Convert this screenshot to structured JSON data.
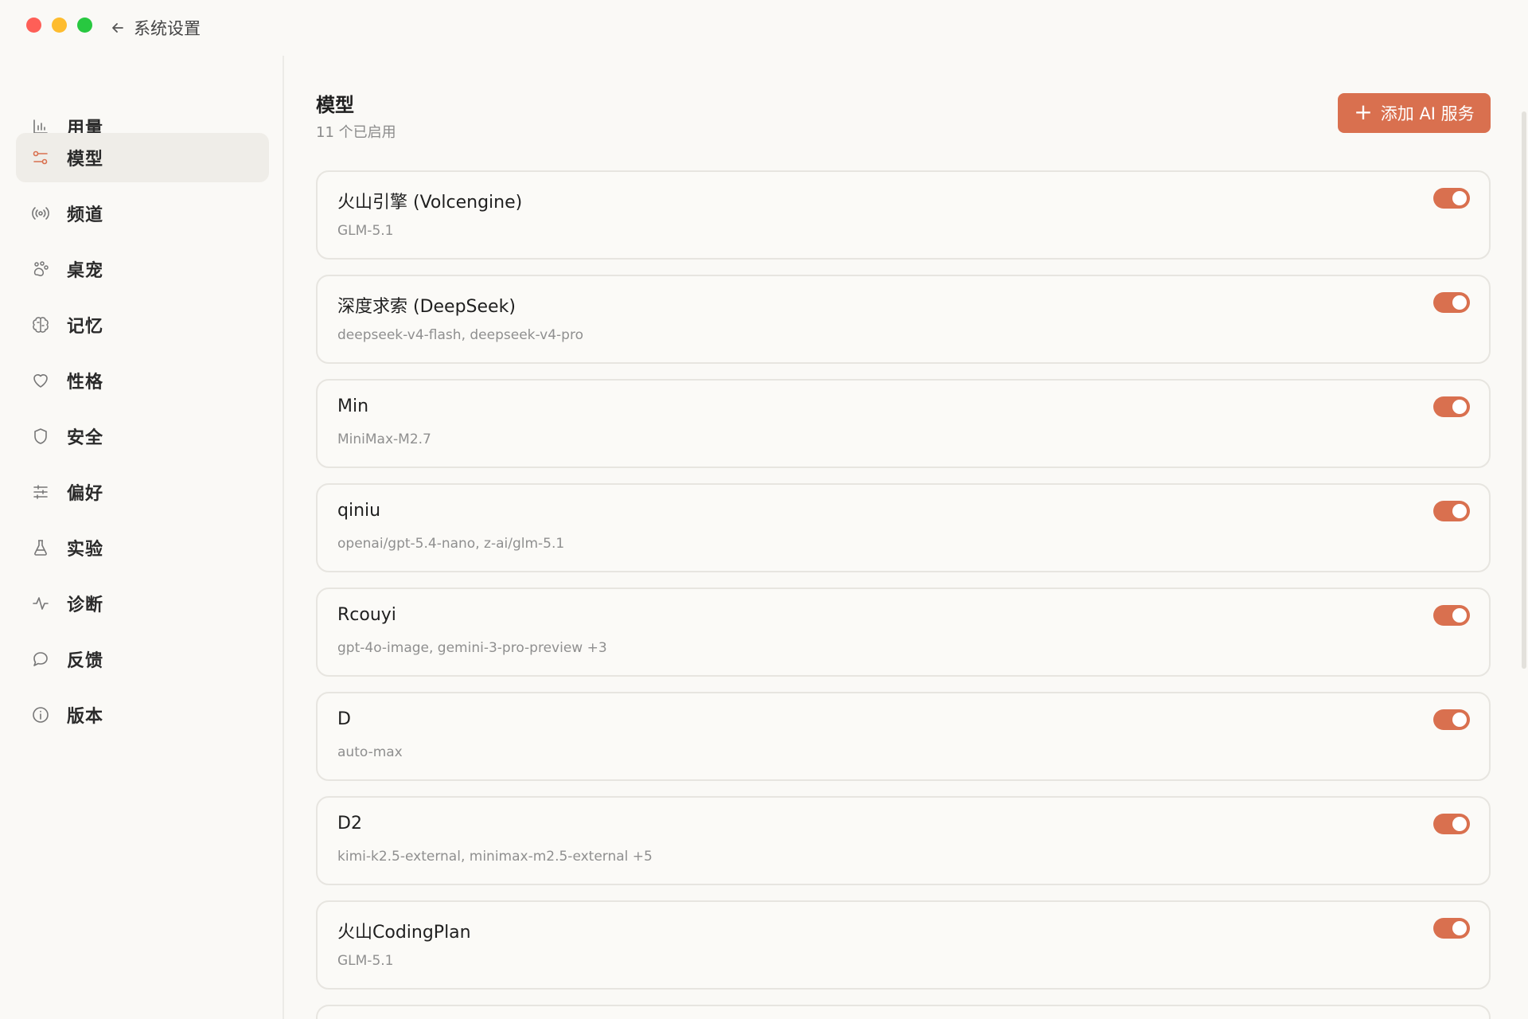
{
  "window": {
    "back_label": "系统设置"
  },
  "sidebar": {
    "items": [
      {
        "label": "用量",
        "icon": "bar-chart-icon",
        "active": false
      },
      {
        "label": "模型",
        "icon": "sliders-link-icon",
        "active": true
      },
      {
        "label": "频道",
        "icon": "broadcast-icon",
        "active": false
      },
      {
        "label": "桌宠",
        "icon": "paw-icon",
        "active": false
      },
      {
        "label": "记忆",
        "icon": "brain-icon",
        "active": false
      },
      {
        "label": "性格",
        "icon": "heart-icon",
        "active": false
      },
      {
        "label": "安全",
        "icon": "shield-icon",
        "active": false
      },
      {
        "label": "偏好",
        "icon": "tune-icon",
        "active": false
      },
      {
        "label": "实验",
        "icon": "flask-icon",
        "active": false
      },
      {
        "label": "诊断",
        "icon": "pulse-icon",
        "active": false
      },
      {
        "label": "反馈",
        "icon": "chat-bubble-icon",
        "active": false
      },
      {
        "label": "版本",
        "icon": "info-icon",
        "active": false
      }
    ]
  },
  "main": {
    "title": "模型",
    "subtitle": "11 个已启用",
    "add_button_label": "添加 AI 服务",
    "providers": [
      {
        "name": "火山引擎 (Volcengine)",
        "models": "GLM-5.1",
        "enabled": true
      },
      {
        "name": "深度求索 (DeepSeek)",
        "models": "deepseek-v4-flash, deepseek-v4-pro",
        "enabled": true
      },
      {
        "name": "Min",
        "models": "MiniMax-M2.7",
        "enabled": true
      },
      {
        "name": "qiniu",
        "models": "openai/gpt-5.4-nano, z-ai/glm-5.1",
        "enabled": true
      },
      {
        "name": "Rcouyi",
        "models": "gpt-4o-image, gemini-3-pro-preview +3",
        "enabled": true
      },
      {
        "name": "D",
        "models": "auto-max",
        "enabled": true
      },
      {
        "name": "D2",
        "models": "kimi-k2.5-external, minimax-m2.5-external +5",
        "enabled": true
      },
      {
        "name": "火山CodingPlan",
        "models": "GLM-5.1",
        "enabled": true
      }
    ]
  },
  "colors": {
    "accent": "#d9704f",
    "background": "#faf9f6",
    "active_nav": "#efede8"
  }
}
